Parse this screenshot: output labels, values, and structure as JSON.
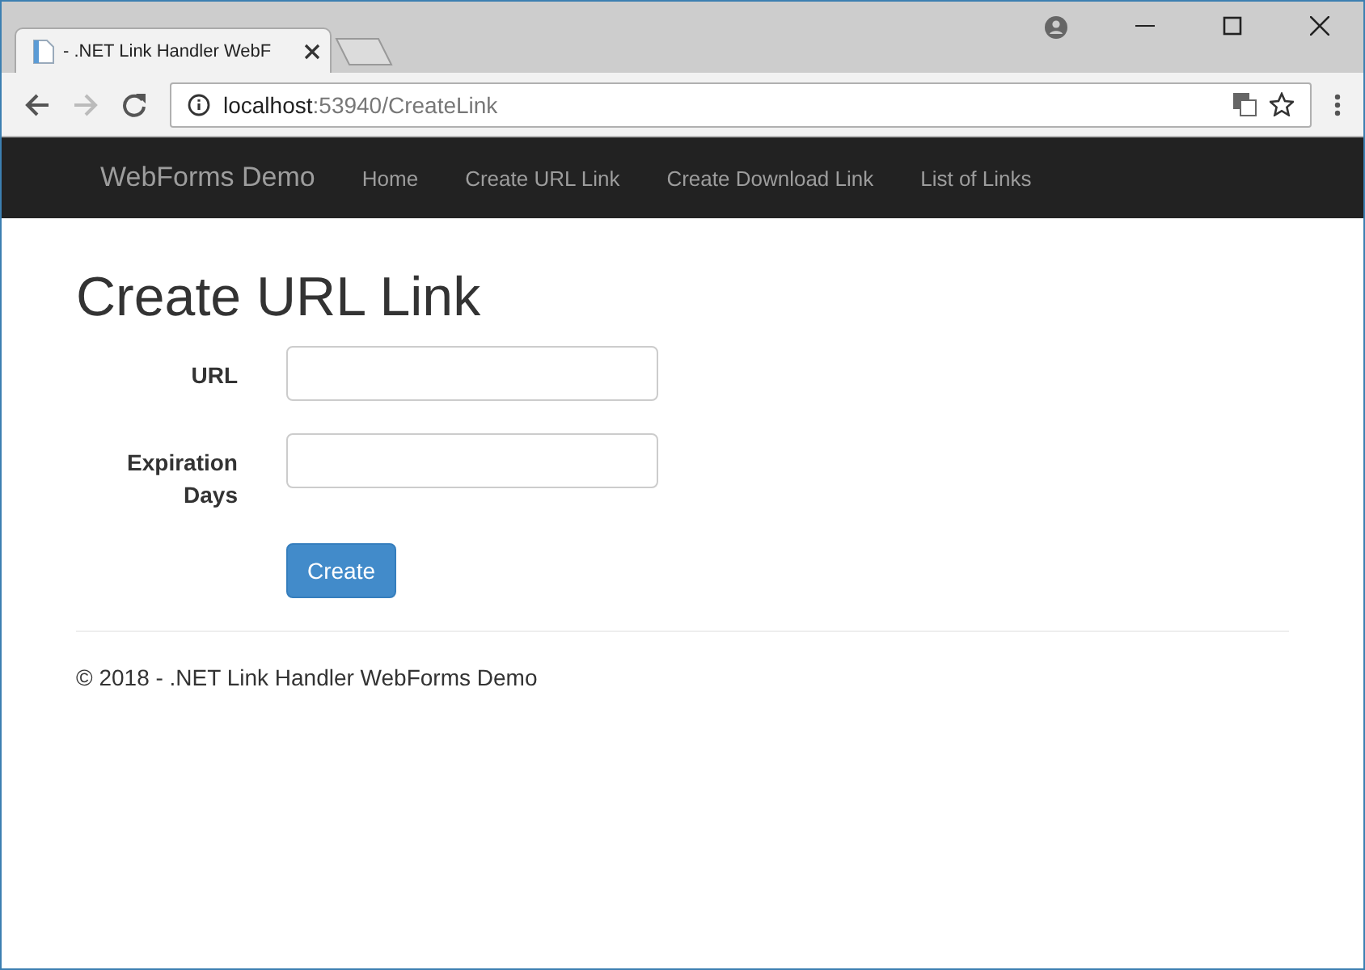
{
  "browser": {
    "tab_title": "- .NET Link Handler WebF",
    "address": {
      "host": "localhost",
      "path": ":53940/CreateLink"
    }
  },
  "navbar": {
    "brand": "WebForms Demo",
    "links": [
      "Home",
      "Create URL Link",
      "Create Download Link",
      "List of Links"
    ]
  },
  "page": {
    "title": "Create URL Link",
    "fields": [
      {
        "label": "URL"
      },
      {
        "label": "Expiration Days"
      }
    ],
    "button": "Create",
    "footer": "© 2018 - .NET Link Handler WebForms Demo"
  }
}
